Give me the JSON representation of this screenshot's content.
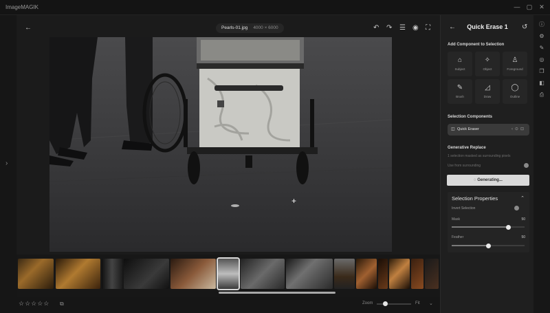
{
  "window": {
    "title": "ImageMAGIK",
    "controls": [
      "—",
      "▢",
      "✕"
    ]
  },
  "canvas": {
    "back_icon": "back-arrow-icon",
    "file_name": "Pearls-01.jpg",
    "file_dims": "4000 × 6000",
    "toolbar_icons": [
      "undo-icon",
      "redo-icon",
      "compare-icon",
      "eye-icon",
      "fullscreen-icon"
    ]
  },
  "filmstrip": {
    "selected_index": 5,
    "thumb_count": 14
  },
  "bottombar": {
    "stars": "☆☆☆☆☆",
    "zoom_label": "Zoom",
    "zoom_value": "Fit",
    "zoom_level": 0.18
  },
  "panel": {
    "title": "Quick Erase 1",
    "add_component_title": "Add Component to Selection",
    "tools": [
      {
        "label": "Subject",
        "icon": "subject-icon",
        "glyph": "⌂"
      },
      {
        "label": "Object",
        "icon": "object-icon",
        "glyph": "✧"
      },
      {
        "label": "Foreground",
        "icon": "person-icon",
        "glyph": "♙"
      },
      {
        "label": "Brush",
        "icon": "brush-icon",
        "glyph": "✎"
      },
      {
        "label": "Draw",
        "icon": "lasso-icon",
        "glyph": "◿"
      },
      {
        "label": "Outline",
        "icon": "circle-icon",
        "glyph": "◯"
      }
    ],
    "selection_components_title": "Selection Components",
    "component_name": "Quick Eraser",
    "generative_title": "Generative Replace",
    "generative_subtext": "1 selection masked as surrounding pixels",
    "generative_option": "Use from surrounding",
    "generate_button": "Generating...",
    "properties": {
      "title": "Selection Properties",
      "invert_label": "Invert Selection",
      "mask_label": "Mask",
      "mask_value": "50",
      "feather_label": "Feather",
      "feather_value": "50"
    }
  },
  "rail": {
    "icons": [
      "info-icon",
      "adjust-icon",
      "edit-icon",
      "mask-icon",
      "layers-icon",
      "erase-icon",
      "export-icon"
    ]
  },
  "colors": {
    "background": "#1a1a1a",
    "panel": "#1f1f1f",
    "accent": "#d9d9d9"
  }
}
